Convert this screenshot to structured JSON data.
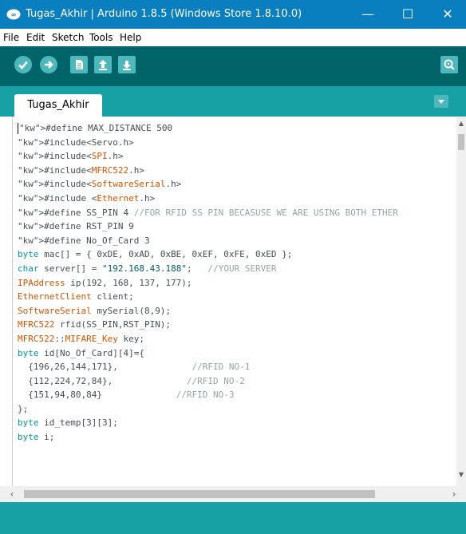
{
  "window": {
    "title": "Tugas_Akhir | Arduino 1.8.5 (Windows Store 1.8.10.0)",
    "minimize_glyph": "—",
    "maximize_glyph": "☐",
    "close_glyph": "✕"
  },
  "menu": {
    "items": [
      "File",
      "Edit",
      "Sketch",
      "Tools",
      "Help"
    ]
  },
  "toolbar": {
    "buttons": [
      "verify-icon",
      "upload-icon",
      "new-icon",
      "open-icon",
      "save-icon"
    ],
    "serial_monitor": "serial-monitor-icon"
  },
  "tabs": {
    "active": "Tugas_Akhir"
  },
  "colors": {
    "titlebar": "#0a7fbf",
    "toolbar": "#006468",
    "tabbar": "#17a1a5",
    "button": "#4db7bb",
    "keyword": "#728e00",
    "type": "#00979c",
    "library": "#d35400",
    "comment": "#95a5a6"
  },
  "code_lines": [
    "#define MAX_DISTANCE 500",
    "#include<Servo.h>",
    "#include<SPI.h>",
    "#include<MFRC522.h>",
    "#include<SoftwareSerial.h>",
    "#include <Ethernet.h>",
    "#define SS_PIN 4 //FOR RFID SS PIN BECASUSE WE ARE USING BOTH ETHER",
    "#define RST_PIN 9",
    "#define No_Of_Card 3",
    "byte mac[] = { 0xDE, 0xAD, 0xBE, 0xEF, 0xFE, 0xED };",
    "char server[] = \"192.168.43.188\";   //YOUR SERVER",
    "IPAddress ip(192, 168, 137, 177);",
    "EthernetClient client;",
    "SoftwareSerial mySerial(8,9);",
    "MFRC522 rfid(SS_PIN,RST_PIN);",
    "MFRC522::MIFARE_Key key;",
    "byte id[No_Of_Card][4]={",
    "  {196,26,144,171},              //RFID NO-1",
    "  {112,224,72,84},              //RFID NO-2",
    "  {151,94,80,84}              //RFID NO-3",
    "};",
    "byte id_temp[3][3];",
    "byte i;"
  ]
}
